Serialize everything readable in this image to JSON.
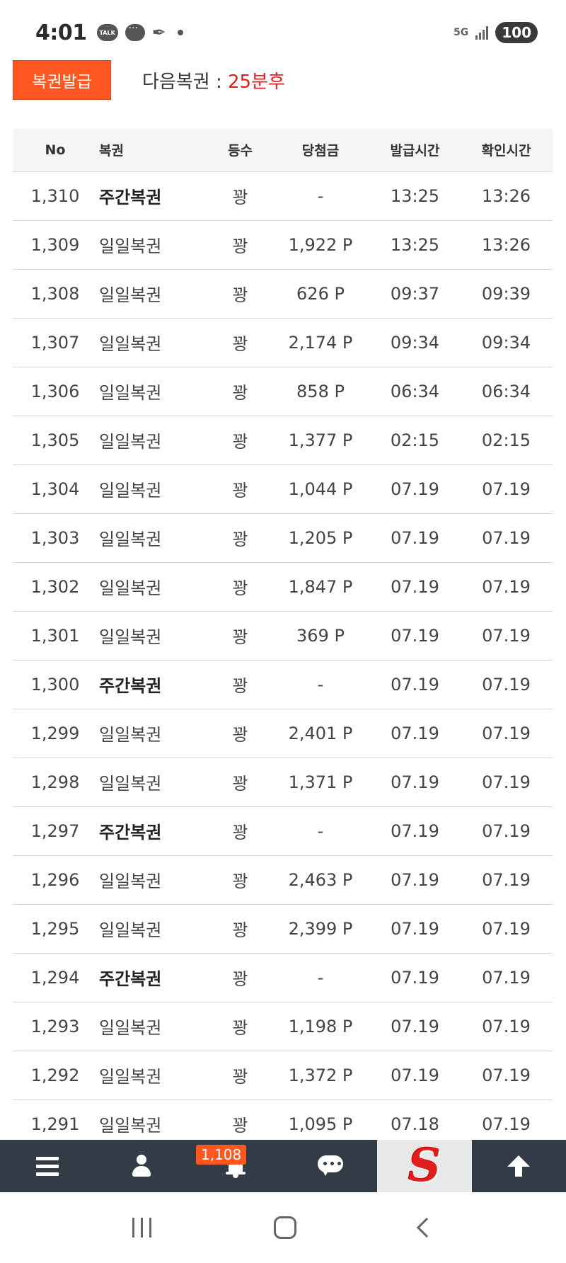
{
  "status_bar": {
    "time": "4:01",
    "talk_icon_text": "TALK",
    "network": "5G",
    "battery": "100"
  },
  "top": {
    "issue_button_label": "복권발급",
    "next_label": "다음복권 : ",
    "next_countdown": "25분후",
    "accent_color": "#ff5722",
    "countdown_color": "#e21f1f"
  },
  "table": {
    "headers": {
      "no": "No",
      "ticket": "복권",
      "rank": "등수",
      "prize": "당첨금",
      "issued": "발급시간",
      "checked": "확인시간"
    },
    "rows": [
      {
        "no": "1,310",
        "ticket": "주간복권",
        "weekly": true,
        "rank": "꽝",
        "prize": "-",
        "issued": "13:25",
        "checked": "13:26"
      },
      {
        "no": "1,309",
        "ticket": "일일복권",
        "weekly": false,
        "rank": "꽝",
        "prize": "1,922 P",
        "issued": "13:25",
        "checked": "13:26"
      },
      {
        "no": "1,308",
        "ticket": "일일복권",
        "weekly": false,
        "rank": "꽝",
        "prize": "626 P",
        "issued": "09:37",
        "checked": "09:39"
      },
      {
        "no": "1,307",
        "ticket": "일일복권",
        "weekly": false,
        "rank": "꽝",
        "prize": "2,174 P",
        "issued": "09:34",
        "checked": "09:34"
      },
      {
        "no": "1,306",
        "ticket": "일일복권",
        "weekly": false,
        "rank": "꽝",
        "prize": "858 P",
        "issued": "06:34",
        "checked": "06:34"
      },
      {
        "no": "1,305",
        "ticket": "일일복권",
        "weekly": false,
        "rank": "꽝",
        "prize": "1,377 P",
        "issued": "02:15",
        "checked": "02:15"
      },
      {
        "no": "1,304",
        "ticket": "일일복권",
        "weekly": false,
        "rank": "꽝",
        "prize": "1,044 P",
        "issued": "07.19",
        "checked": "07.19"
      },
      {
        "no": "1,303",
        "ticket": "일일복권",
        "weekly": false,
        "rank": "꽝",
        "prize": "1,205 P",
        "issued": "07.19",
        "checked": "07.19"
      },
      {
        "no": "1,302",
        "ticket": "일일복권",
        "weekly": false,
        "rank": "꽝",
        "prize": "1,847 P",
        "issued": "07.19",
        "checked": "07.19"
      },
      {
        "no": "1,301",
        "ticket": "일일복권",
        "weekly": false,
        "rank": "꽝",
        "prize": "369 P",
        "issued": "07.19",
        "checked": "07.19"
      },
      {
        "no": "1,300",
        "ticket": "주간복권",
        "weekly": true,
        "rank": "꽝",
        "prize": "-",
        "issued": "07.19",
        "checked": "07.19"
      },
      {
        "no": "1,299",
        "ticket": "일일복권",
        "weekly": false,
        "rank": "꽝",
        "prize": "2,401 P",
        "issued": "07.19",
        "checked": "07.19"
      },
      {
        "no": "1,298",
        "ticket": "일일복권",
        "weekly": false,
        "rank": "꽝",
        "prize": "1,371 P",
        "issued": "07.19",
        "checked": "07.19"
      },
      {
        "no": "1,297",
        "ticket": "주간복권",
        "weekly": true,
        "rank": "꽝",
        "prize": "-",
        "issued": "07.19",
        "checked": "07.19"
      },
      {
        "no": "1,296",
        "ticket": "일일복권",
        "weekly": false,
        "rank": "꽝",
        "prize": "2,463 P",
        "issued": "07.19",
        "checked": "07.19"
      },
      {
        "no": "1,295",
        "ticket": "일일복권",
        "weekly": false,
        "rank": "꽝",
        "prize": "2,399 P",
        "issued": "07.19",
        "checked": "07.19"
      },
      {
        "no": "1,294",
        "ticket": "주간복권",
        "weekly": true,
        "rank": "꽝",
        "prize": "-",
        "issued": "07.19",
        "checked": "07.19"
      },
      {
        "no": "1,293",
        "ticket": "일일복권",
        "weekly": false,
        "rank": "꽝",
        "prize": "1,198 P",
        "issued": "07.19",
        "checked": "07.19"
      },
      {
        "no": "1,292",
        "ticket": "일일복권",
        "weekly": false,
        "rank": "꽝",
        "prize": "1,372 P",
        "issued": "07.19",
        "checked": "07.19"
      },
      {
        "no": "1,291",
        "ticket": "일일복권",
        "weekly": false,
        "rank": "꽝",
        "prize": "1,095 P",
        "issued": "07.18",
        "checked": "07.19"
      }
    ]
  },
  "bottom_nav": {
    "notification_count": "1,108",
    "logo_letter": "S",
    "items": [
      "menu-icon",
      "user-icon",
      "bell-icon",
      "chat-icon",
      "logo",
      "arrow-up-icon"
    ]
  },
  "system_nav": {
    "items": [
      "recent-apps-icon",
      "home-icon",
      "back-icon"
    ]
  }
}
